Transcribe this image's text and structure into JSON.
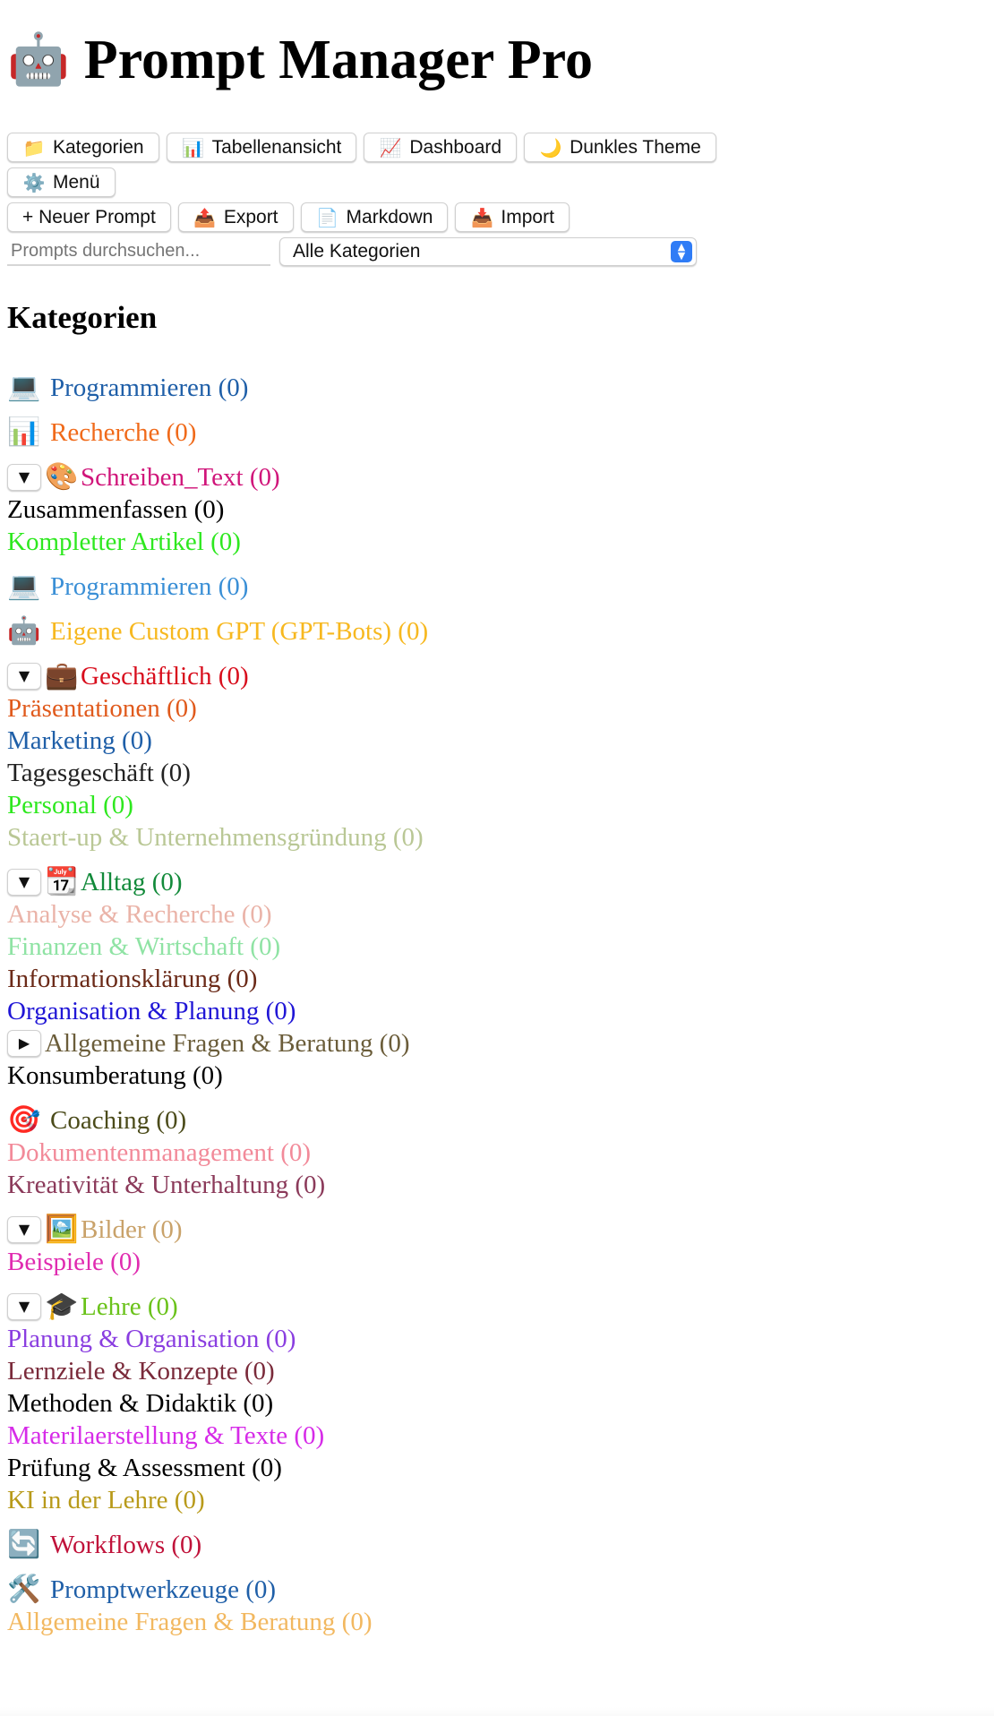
{
  "app": {
    "title": "Prompt Manager Pro",
    "logo_icon": "robot-icon",
    "logo_glyph": "🤖"
  },
  "toolbar": {
    "row1": [
      {
        "name": "categories-button",
        "icon": "folder-icon",
        "glyph": "📁",
        "label": "Kategorien"
      },
      {
        "name": "table-view-button",
        "icon": "bar-chart-icon",
        "glyph": "📊",
        "label": "Tabellenansicht"
      },
      {
        "name": "dashboard-button",
        "icon": "line-chart-icon",
        "glyph": "📈",
        "label": "Dashboard"
      },
      {
        "name": "dark-theme-button",
        "icon": "moon-icon",
        "glyph": "🌙",
        "label": "Dunkles Theme"
      },
      {
        "name": "menu-button",
        "icon": "gear-icon",
        "glyph": "⚙️",
        "label": "Menü"
      }
    ],
    "row2": [
      {
        "name": "new-prompt-button",
        "icon": "plus-icon",
        "glyph": "",
        "label": "+ Neuer Prompt"
      },
      {
        "name": "export-button",
        "icon": "outbox-tray-icon",
        "glyph": "📤",
        "label": "Export"
      },
      {
        "name": "markdown-button",
        "icon": "document-icon",
        "glyph": "📄",
        "label": "Markdown"
      },
      {
        "name": "import-button",
        "icon": "inbox-tray-icon",
        "glyph": "📥",
        "label": "Import"
      }
    ]
  },
  "filters": {
    "search_placeholder": "Prompts durchsuchen...",
    "category_select_value": "Alle Kategorien"
  },
  "sidebar": {
    "heading": "Kategorien",
    "items": [
      {
        "kind": "top",
        "toggle": "",
        "icon": "laptop-icon",
        "glyph": "💻",
        "label": "Programmieren (0)",
        "color": "#1f5fa8"
      },
      {
        "kind": "top",
        "toggle": "",
        "icon": "bar-chart-icon",
        "glyph": "📊",
        "label": "Recherche (0)",
        "color": "#f06a1a"
      },
      {
        "kind": "top",
        "toggle": "▼",
        "icon": "palette-icon",
        "glyph": "🎨",
        "label": "Schreiben_Text (0)",
        "color": "#d0157a"
      },
      {
        "kind": "sub",
        "label": "Zusammenfassen (0)",
        "color": "#000000"
      },
      {
        "kind": "sub",
        "label": "Kompletter Artikel (0)",
        "color": "#2ee81f"
      },
      {
        "kind": "top",
        "toggle": "",
        "icon": "laptop-icon",
        "glyph": "💻",
        "label": "Programmieren (0)",
        "color": "#3a8fd6"
      },
      {
        "kind": "top",
        "toggle": "",
        "icon": "robot-icon",
        "glyph": "🤖",
        "label": "Eigene Custom GPT (GPT-Bots) (0)",
        "color": "#f7b81f"
      },
      {
        "kind": "top",
        "toggle": "▼",
        "icon": "briefcase-icon",
        "glyph": "💼",
        "label": "Geschäftlich (0)",
        "color": "#d80d1c"
      },
      {
        "kind": "sub",
        "label": "Präsentationen (0)",
        "color": "#e05a1c"
      },
      {
        "kind": "sub",
        "label": "Marketing (0)",
        "color": "#1f5fa8"
      },
      {
        "kind": "sub",
        "label": "Tagesgeschäft (0)",
        "color": "#222222"
      },
      {
        "kind": "sub",
        "label": "Personal (0)",
        "color": "#2ee81f"
      },
      {
        "kind": "sub",
        "label": "Staert-up & Unternehmensgründung (0)",
        "color": "#b9c795"
      },
      {
        "kind": "top",
        "toggle": "▼",
        "icon": "calendar-icon",
        "glyph": "📆",
        "label": "Alltag (0)",
        "color": "#128a3a"
      },
      {
        "kind": "sub",
        "label": "Analyse & Recherche (0)",
        "color": "#eab3a8"
      },
      {
        "kind": "sub",
        "label": "Finanzen & Wirtschaft (0)",
        "color": "#8fe3a4"
      },
      {
        "kind": "sub",
        "label": "Informationsklärung (0)",
        "color": "#6b2a18"
      },
      {
        "kind": "sub",
        "label": "Organisation & Planung (0)",
        "color": "#2016d6"
      },
      {
        "kind": "sub",
        "toggle": "▶",
        "label": "Allgemeine Fragen & Beratung (0)",
        "color": "#6b5d3a"
      },
      {
        "kind": "sub",
        "label": "Konsumberatung (0)",
        "color": "#000000"
      },
      {
        "kind": "top",
        "toggle": "",
        "icon": "target-icon",
        "glyph": "🎯",
        "label": "Coaching (0)",
        "color": "#4b4b1a"
      },
      {
        "kind": "sub",
        "label": "Dokumentenmanagement (0)",
        "color": "#f28a99"
      },
      {
        "kind": "sub",
        "label": "Kreativität & Unterhaltung (0)",
        "color": "#8b3a5a"
      },
      {
        "kind": "top",
        "toggle": "▼",
        "icon": "framed-picture-icon",
        "glyph": "🖼️",
        "label": "Bilder (0)",
        "color": "#c9a26a"
      },
      {
        "kind": "sub",
        "label": "Beispiele (0)",
        "color": "#e02bb0"
      },
      {
        "kind": "top",
        "toggle": "▼",
        "icon": "graduation-cap-icon",
        "glyph": "🎓",
        "label": "Lehre (0)",
        "color": "#6ac21a"
      },
      {
        "kind": "sub",
        "label": "Planung & Organisation (0)",
        "color": "#8a3ee0"
      },
      {
        "kind": "sub",
        "label": "Lernziele & Konzepte (0)",
        "color": "#7a2a3a"
      },
      {
        "kind": "sub",
        "label": "Methoden & Didaktik (0)",
        "color": "#000000"
      },
      {
        "kind": "sub",
        "label": "Materilaerstellung & Texte (0)",
        "color": "#d62be8"
      },
      {
        "kind": "sub",
        "label": "Prüfung & Assessment (0)",
        "color": "#000000"
      },
      {
        "kind": "sub",
        "label": "KI in der Lehre (0)",
        "color": "#b89a1a"
      },
      {
        "kind": "top",
        "toggle": "",
        "icon": "arrows-cycle-icon",
        "glyph": "🔄",
        "label": "Workflows (0)",
        "color": "#c0123a"
      },
      {
        "kind": "top",
        "toggle": "",
        "icon": "hammer-wrench-icon",
        "glyph": "🛠️",
        "label": "Promptwerkzeuge (0)",
        "color": "#1f5fa8"
      },
      {
        "kind": "sub",
        "label": "Allgemeine Fragen & Beratung (0)",
        "color": "#f2b860"
      }
    ]
  }
}
